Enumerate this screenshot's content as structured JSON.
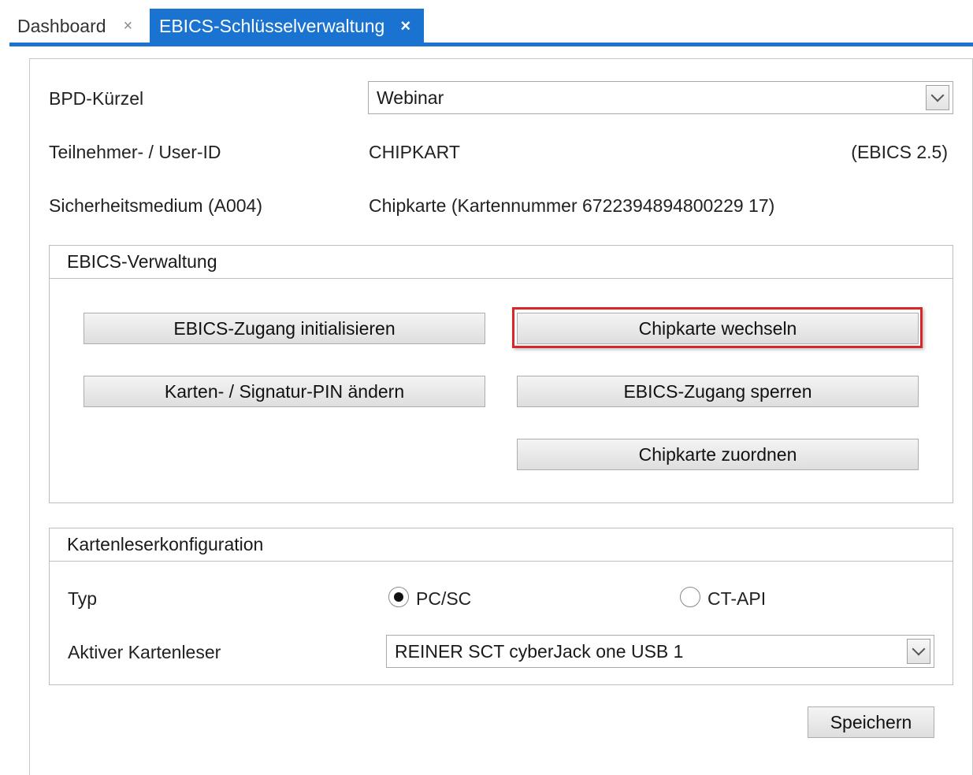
{
  "tabs": [
    {
      "label": "Dashboard",
      "close": "×",
      "active": false
    },
    {
      "label": "EBICS-Schlüsselverwaltung",
      "close": "×",
      "active": true
    }
  ],
  "form": {
    "bpd_label": "BPD-Kürzel",
    "bpd_value": "Webinar",
    "user_label": "Teilnehmer- / User-ID",
    "user_value": "CHIPKART",
    "ebics_version": "(EBICS 2.5)",
    "medium_label": "Sicherheitsmedium (A004)",
    "medium_value": "Chipkarte (Kartennummer 6722394894800229 17)"
  },
  "ebics_group": {
    "title": "EBICS-Verwaltung",
    "buttons": {
      "init": "EBICS-Zugang initialisieren",
      "change_card": "Chipkarte wechseln",
      "change_pin": "Karten- / Signatur-PIN ändern",
      "lock": "EBICS-Zugang sperren",
      "assign_card": "Chipkarte zuordnen"
    }
  },
  "reader_group": {
    "title": "Kartenleserkonfiguration",
    "type_label": "Typ",
    "options": [
      {
        "label": "PC/SC",
        "selected": true
      },
      {
        "label": "CT-API",
        "selected": false
      }
    ],
    "active_label": "Aktiver Kartenleser",
    "active_value": "REINER SCT cyberJack one USB 1"
  },
  "save_label": "Speichern",
  "colors": {
    "accent": "#1a73d1",
    "highlight": "#d9262b"
  }
}
